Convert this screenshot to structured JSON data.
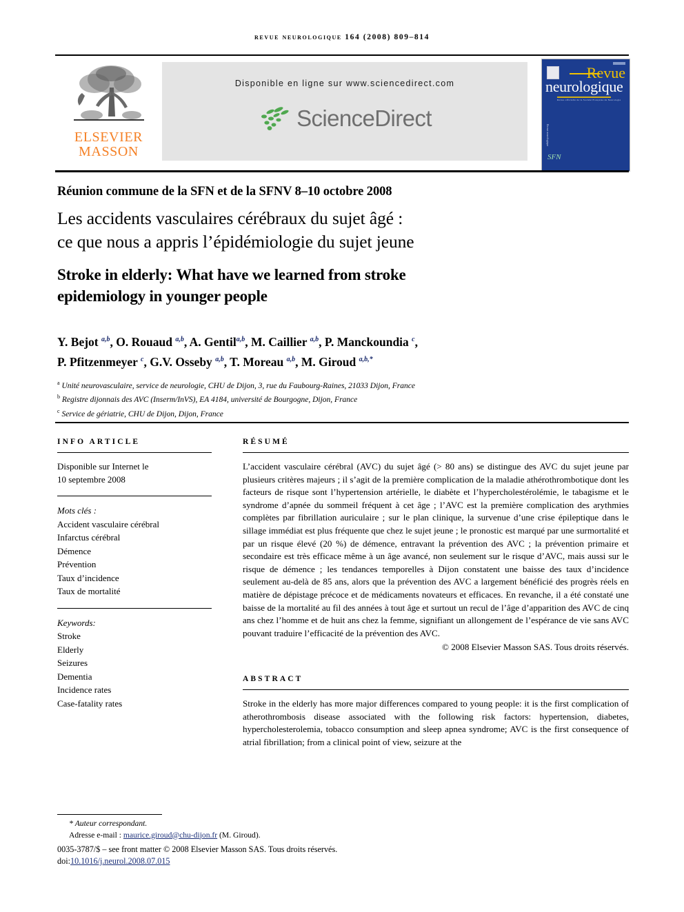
{
  "running_head": "Revue neurologique 164 (2008) 809–814",
  "masthead": {
    "publisher_line1": "ELSEVIER",
    "publisher_line2": "MASSON",
    "publisher_logo_alt": "tree-logo",
    "available_online": "Disponible en ligne sur www.sciencedirect.com",
    "sciencedirect_word": "ScienceDirect",
    "journal_cover": {
      "title_word1": "Revue",
      "title_word2": "neurologique",
      "subtitle": "Revue officielle de la Société Française de Neurologie",
      "spine_text": "Revue neurologique",
      "society_mark": "SFN"
    }
  },
  "article": {
    "conference": "Réunion commune de la SFN et de la SFNV 8–10 octobre 2008",
    "title_fr_line1": "Les accidents vasculaires cérébraux du sujet âgé :",
    "title_fr_line2": "ce que nous a appris l’épidémiologie du sujet jeune",
    "title_en_line1": "Stroke in elderly: What have we learned from stroke",
    "title_en_line2": "epidemiology in younger people",
    "authors_line1": "Y. Bejot <sup>a,b</sup>, O. Rouaud <sup>a,b</sup>, A. Gentil<sup>a,b</sup>, M. Caillier <sup>a,b</sup>, P. Manckoundia <sup>c</sup>,",
    "authors_line2": "P. Pfitzenmeyer <sup>c</sup>, G.V. Osseby <sup>a,b</sup>, T. Moreau <sup>a,b</sup>, M. Giroud <sup>a,b,</sup><sup>*</sup>",
    "affiliations": [
      "<sup>a</sup> Unité neurovasculaire, service de neurologie, CHU de Dijon, 3, rue du Faubourg-Raines, 21033 Dijon, France",
      "<sup>b</sup> Registre dijonnais des AVC (Inserm/InVS), EA 4184, université de Bourgogne, Dijon, France",
      "<sup>c</sup> Service de gériatrie, CHU de Dijon, Dijon, France"
    ]
  },
  "info_article": {
    "heading": "INFO ARTICLE",
    "history_line1": "Disponible sur Internet le",
    "history_line2": "10 septembre 2008",
    "keywords_fr_label": "Mots clés :",
    "keywords_fr": [
      "Accident vasculaire cérébral",
      "Infarctus cérébral",
      "Démence",
      "Prévention",
      "Taux d’incidence",
      "Taux de mortalité"
    ],
    "keywords_en_label": "Keywords:",
    "keywords_en": [
      "Stroke",
      "Elderly",
      "Seizures",
      "Dementia",
      "Incidence rates",
      "Case-fatality rates"
    ]
  },
  "resume": {
    "heading": "RÉSUMÉ",
    "body": "L’accident vasculaire cérébral (AVC) du sujet âgé (&gt; 80 ans) se distingue des AVC du sujet jeune par plusieurs critères majeurs ; il s’agit de la première complication de la maladie athérothrombotique dont les facteurs de risque sont l’hypertension artérielle, le diabète et l’hypercholestérolémie, le tabagisme et le syndrome d’apnée du sommeil fréquent à cet âge ; l’AVC est la première complication des arythmies complètes par fibrillation auriculaire ; sur le plan clinique, la survenue d’une crise épileptique dans le sillage immédiat est plus fréquente que chez le sujet jeune ; le pronostic est marqué par une surmortalité et par un risque élevé (20 %) de démence, entravant la prévention des AVC ; la prévention primaire et secondaire est très efficace même à un âge avancé, non seulement sur le risque d’AVC, mais aussi sur le risque de démence ; les tendances temporelles à Dijon constatent une baisse des taux d’incidence seulement au-delà de 85 ans, alors que la prévention des AVC a largement bénéficié des progrès réels en matière de dépistage précoce et de médicaments novateurs et efficaces. En revanche, il a été constaté une baisse de la mortalité au fil des années à tout âge et surtout un recul de l’âge d’apparition des AVC de cinq ans chez l’homme et de huit ans chez la femme, signifiant un allongement de l’espérance de vie sans AVC pouvant traduire l’efficacité de la prévention des AVC.",
    "copyright": "© 2008 Elsevier Masson SAS. Tous droits réservés."
  },
  "abstract": {
    "heading": "ABSTRACT",
    "body": "Stroke in the elderly has more major differences compared to young people: it is the first complication of atherothrombosis disease associated with the following risk factors: hypertension, diabetes, hypercholesterolemia, tobacco consumption and sleep apnea syndrome; AVC is the first consequence of atrial fibrillation; from a clinical point of view, seizure at the"
  },
  "footer": {
    "corresponding_label": "Auteur correspondant.",
    "email_label": "Adresse e-mail :",
    "email": "maurice.giroud@chu-dijon.fr",
    "email_owner": "(M. Giroud).",
    "front_matter": "0035-3787/$ – see front matter © 2008 Elsevier Masson SAS. Tous droits réservés.",
    "doi_label": "doi:",
    "doi": "10.1016/j.neurol.2008.07.015"
  },
  "colors": {
    "elsevier_orange": "#f58025",
    "cover_blue": "#1c3d8f",
    "cover_yellow": "#f2c200",
    "sciencedirect_green": "#4fa84f",
    "sciencedirect_gray": "#6f6f6f",
    "link_blue": "#1b2f78",
    "banner_gray": "#e4e4e4"
  }
}
